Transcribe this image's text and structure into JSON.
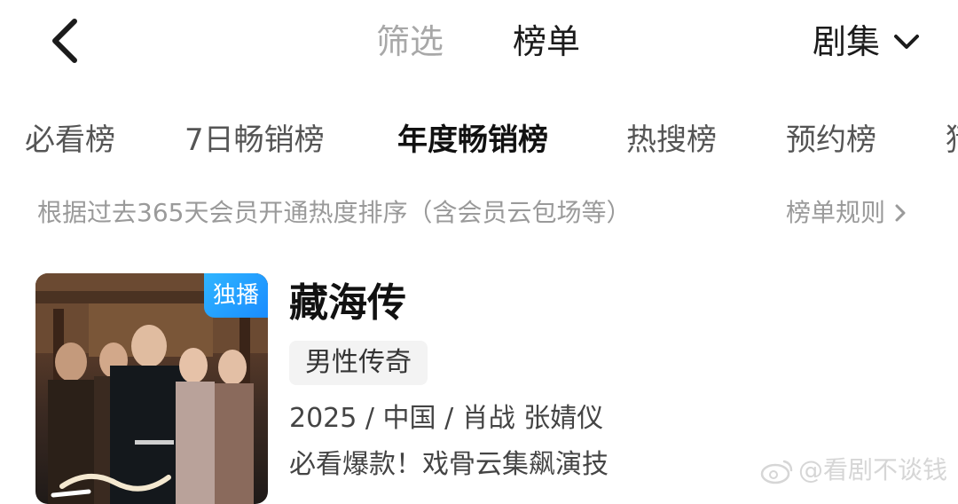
{
  "header": {
    "filter_label": "筛选",
    "ranking_label": "榜单",
    "category_label": "剧集"
  },
  "rank_tabs": [
    {
      "label": "必看榜"
    },
    {
      "label": "7日畅销榜"
    },
    {
      "label": "年度畅销榜"
    },
    {
      "label": "热搜榜"
    },
    {
      "label": "预约榜"
    },
    {
      "label": "猜"
    }
  ],
  "selected_rank_tab": "年度畅销榜",
  "description": "根据过去365天会员开通热度排序（含会员云包场等）",
  "rules_label": "榜单规则",
  "show": {
    "badge": "独播",
    "title": "藏海传",
    "genre": "男性传奇",
    "meta": "2025 / 中国 / 肖战 张婧仪",
    "tagline": "必看爆款！戏骨云集飙演技"
  },
  "watermark": "@看剧不谈钱",
  "colors": {
    "badge": "#1a8cff",
    "active_text": "#111111",
    "inactive_text": "#a8a8a8"
  }
}
